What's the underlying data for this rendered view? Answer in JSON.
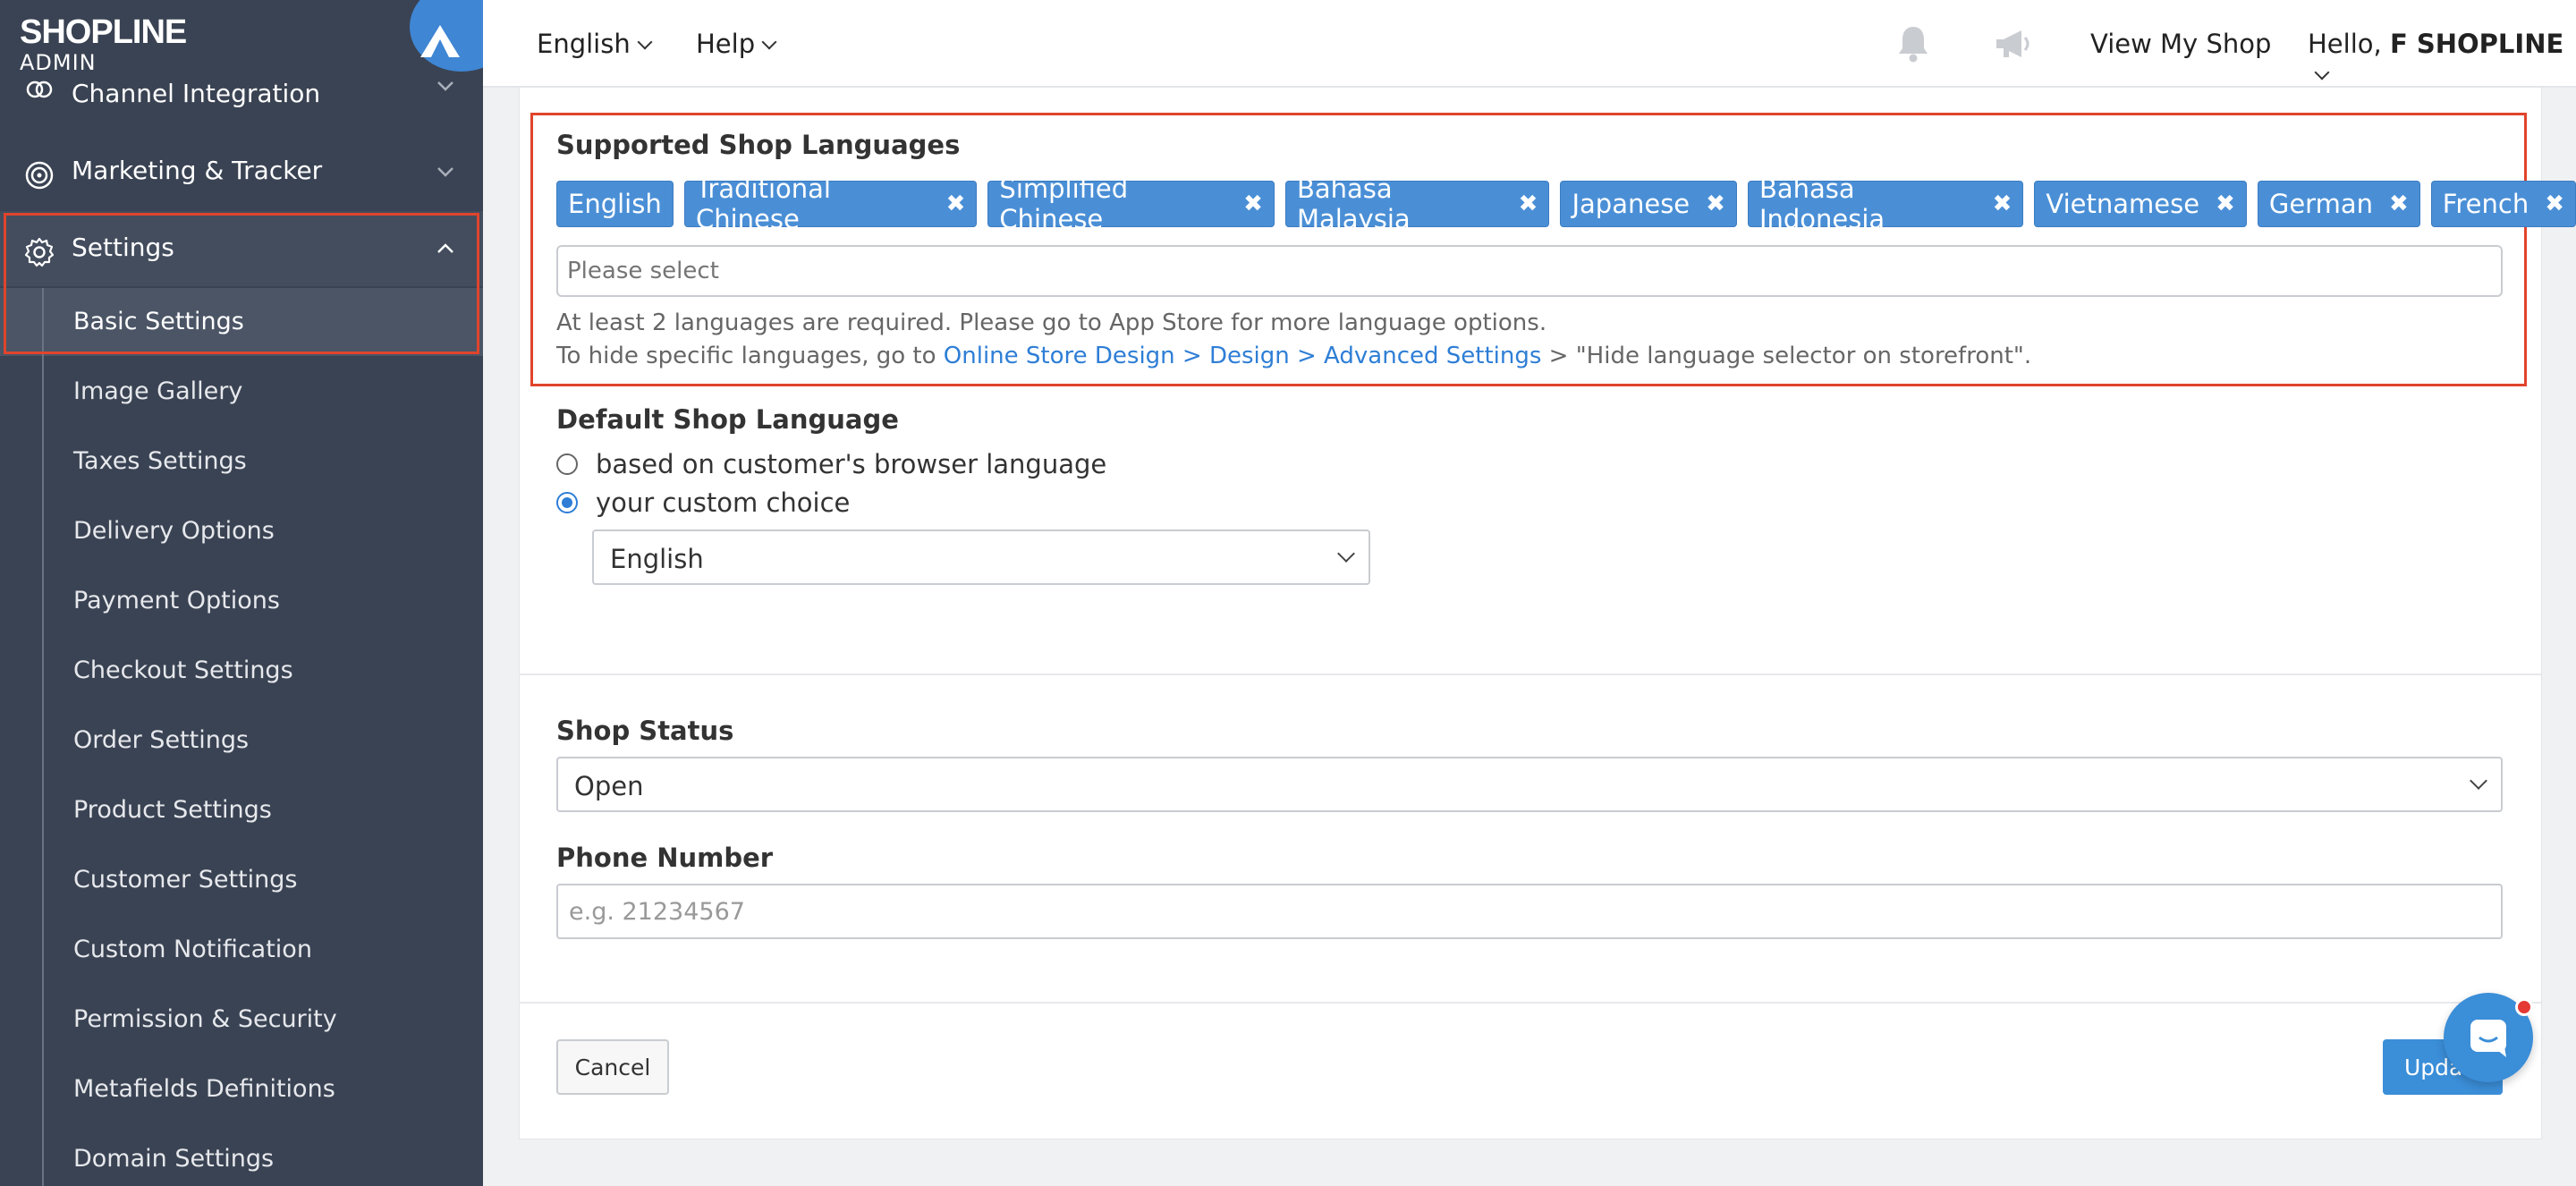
{
  "brand": {
    "name": "SHOPLINE",
    "sub": "ADMIN"
  },
  "sidebar": {
    "items": [
      {
        "label": "Channel Integration"
      },
      {
        "label": "Marketing & Tracker"
      },
      {
        "label": "Settings"
      }
    ],
    "sub_items": [
      "Basic Settings",
      "Image Gallery",
      "Taxes Settings",
      "Delivery Options",
      "Payment Options",
      "Checkout Settings",
      "Order Settings",
      "Product Settings",
      "Customer Settings",
      "Custom Notification",
      "Permission & Security",
      "Metafields Definitions",
      "Domain Settings"
    ]
  },
  "topbar": {
    "language": "English",
    "help": "Help",
    "view_shop": "View My Shop",
    "greeting": "Hello,",
    "user": "F SHOPLINE"
  },
  "languages": {
    "title": "Supported Shop Languages",
    "tags": [
      {
        "label": "English",
        "removable": false
      },
      {
        "label": "Traditional Chinese",
        "removable": true
      },
      {
        "label": "Simplified Chinese",
        "removable": true
      },
      {
        "label": "Bahasa Malaysia",
        "removable": true
      },
      {
        "label": "Japanese",
        "removable": true
      },
      {
        "label": "Bahasa Indonesia",
        "removable": true
      },
      {
        "label": "Vietnamese",
        "removable": true
      },
      {
        "label": "German",
        "removable": true
      },
      {
        "label": "French",
        "removable": true
      }
    ],
    "remove_glyph": "✖",
    "placeholder": "Please select",
    "help_line1": "At least 2 languages are required. Please go to App Store for more language options.",
    "help_line2_pre": "To hide specific languages, go to ",
    "help_link": "Online Store Design > Design > Advanced Settings",
    "help_line2_post": " > \"Hide language selector on storefront\"."
  },
  "default_language": {
    "title": "Default Shop Language",
    "option1": "based on customer's browser language",
    "option2": "your custom choice",
    "selected": "English"
  },
  "shop_status": {
    "title": "Shop Status",
    "value": "Open"
  },
  "phone": {
    "title": "Phone Number",
    "placeholder": "e.g. 21234567"
  },
  "actions": {
    "cancel": "Cancel",
    "update": "Update"
  },
  "colors": {
    "sidebar_bg": "#3a4353",
    "accent": "#3b8ed8",
    "highlight": "#e0442c"
  }
}
